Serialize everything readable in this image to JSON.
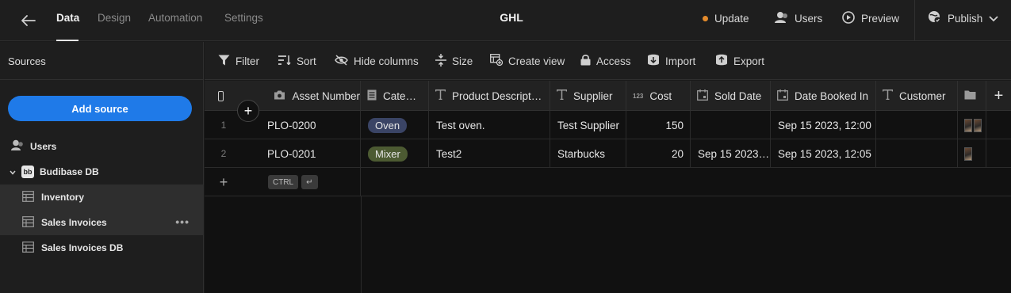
{
  "topbar": {
    "tabs": [
      {
        "label": "Data",
        "active": true
      },
      {
        "label": "Design",
        "active": false
      },
      {
        "label": "Automation",
        "active": false
      },
      {
        "label": "Settings",
        "active": false
      }
    ],
    "app_title": "GHL",
    "update_label": "Update",
    "users_label": "Users",
    "preview_label": "Preview",
    "publish_label": "Publish",
    "update_dot_color": "#e48b2c"
  },
  "sidebar": {
    "heading": "Sources",
    "add_source_label": "Add source",
    "items": [
      {
        "label": "Users",
        "icon": "users-icon"
      },
      {
        "label": "Budibase DB",
        "icon": "budibase-db-icon",
        "logo_text": "bb"
      },
      {
        "label": "Inventory",
        "icon": "table-icon",
        "selected": true
      },
      {
        "label": "Sales Invoices",
        "icon": "table-icon",
        "selected": true,
        "more": "•••"
      },
      {
        "label": "Sales Invoices DB",
        "icon": "table-icon",
        "selected": false
      }
    ]
  },
  "toolbar": {
    "filter": "Filter",
    "sort": "Sort",
    "hide_columns": "Hide columns",
    "size": "Size",
    "create_view": "Create view",
    "access": "Access",
    "import": "Import",
    "export": "Export"
  },
  "table": {
    "columns": [
      {
        "label": "Asset Number",
        "icon": "camera-icon"
      },
      {
        "label": "Cate…",
        "icon": "list-icon"
      },
      {
        "label": "Product Descript…",
        "icon": "text-icon"
      },
      {
        "label": "Supplier",
        "icon": "text-icon"
      },
      {
        "label": "Cost",
        "icon": "number-icon",
        "icon_text": "123"
      },
      {
        "label": "Sold Date",
        "icon": "calendar-icon"
      },
      {
        "label": "Date Booked In",
        "icon": "calendar-icon"
      },
      {
        "label": "Customer",
        "icon": "text-icon"
      },
      {
        "label": "",
        "icon": "folder-icon"
      }
    ],
    "rows": [
      {
        "num": "1",
        "asset": "PLO-0200",
        "category": "Oven",
        "category_color": "#3a4465",
        "description": "Test oven.",
        "supplier": "Test Supplier",
        "cost": "150",
        "sold_date": "",
        "booked": "Sep 15 2023, 12:00",
        "customer": ""
      },
      {
        "num": "2",
        "asset": "PLO-0201",
        "category": "Mixer",
        "category_color": "#4c5a32",
        "description": "Test2",
        "supplier": "Starbucks",
        "cost": "20",
        "sold_date": "Sep 15 2023…",
        "booked": "Sep 15 2023, 12:05",
        "customer": ""
      }
    ],
    "new_row_keys": [
      "CTRL",
      "↵"
    ]
  }
}
